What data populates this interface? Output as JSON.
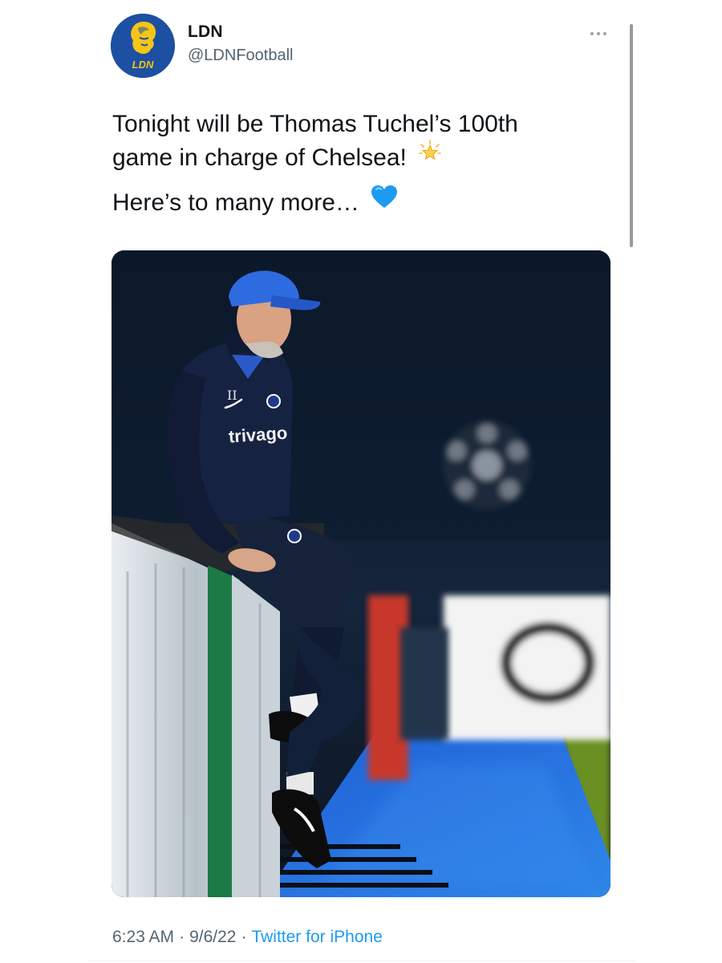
{
  "tweet": {
    "author": {
      "display_name": "LDN",
      "handle": "@LDNFootball",
      "avatar_text": "LDN",
      "avatar_icon": "lion-logo-icon"
    },
    "text_lines": [
      "Tonight will be Thomas Tuchel’s 100th",
      "game in charge of Chelsea!",
      "Here’s to many more…"
    ],
    "emojis": [
      "glowing-star-icon",
      "blue-heart-icon"
    ],
    "media": {
      "type": "photo",
      "shirt_sponsor": "trivago",
      "shirt_number": "II"
    },
    "timestamp": {
      "time": "6:23 AM",
      "date": "9/6/22",
      "source": "Twitter for iPhone",
      "separator": "·"
    },
    "more_icon": "more-options-icon"
  },
  "colors": {
    "text_primary": "#0f1419",
    "text_secondary": "#536471",
    "link": "#1d9bf0",
    "avatar_bg": "#1d4fa3",
    "avatar_accent": "#f5c518",
    "heart": "#1d9bf0"
  }
}
